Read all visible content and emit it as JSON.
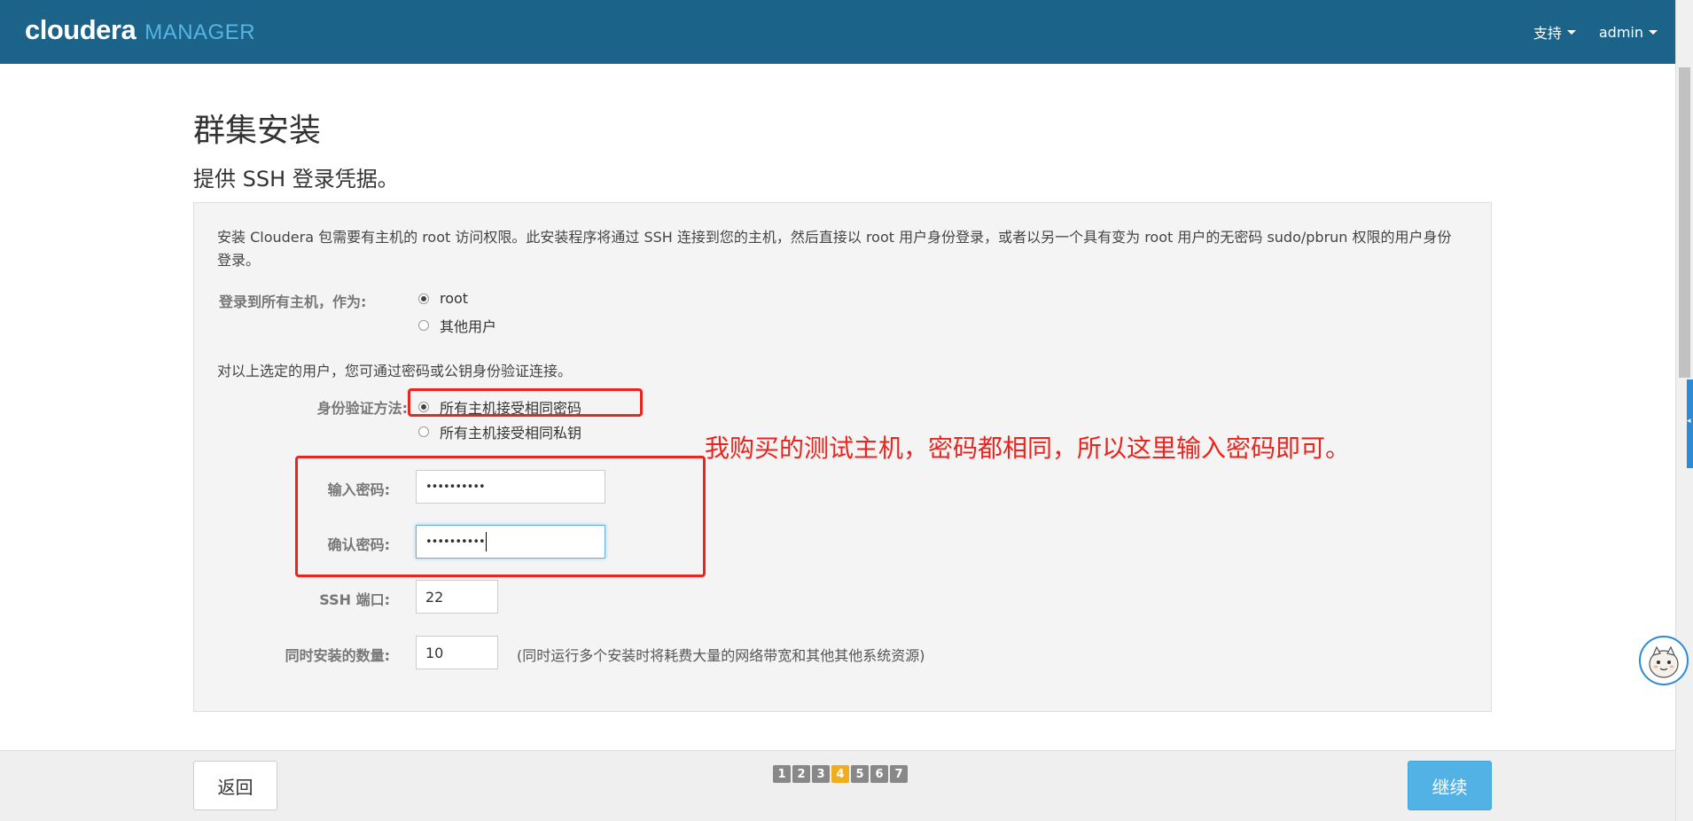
{
  "header": {
    "brand_primary": "cloudera",
    "brand_secondary": "MANAGER",
    "support_menu": "支持",
    "user_menu": "admin"
  },
  "page": {
    "title": "群集安装",
    "subtitle": "提供 SSH 登录凭据。"
  },
  "form": {
    "intro": "安装 Cloudera 包需要有主机的 root 访问权限。此安装程序将通过 SSH 连接到您的主机，然后直接以 root 用户身份登录，或者以另一个具有变为 root 用户的无密码 sudo/pbrun 权限的用户身份登录。",
    "login_as_label": "登录到所有主机，作为:",
    "login_options": [
      {
        "label": "root",
        "checked": true
      },
      {
        "label": "其他用户",
        "checked": false
      }
    ],
    "auth_intro": "对以上选定的用户，您可通过密码或公钥身份验证连接。",
    "auth_method_label": "身份验证方法:",
    "auth_options": [
      {
        "label": "所有主机接受相同密码",
        "checked": true
      },
      {
        "label": "所有主机接受相同私钥",
        "checked": false
      }
    ],
    "password_label": "输入密码:",
    "password_value": "••••••••••",
    "confirm_label": "确认密码:",
    "confirm_value": "••••••••••",
    "ssh_port_label": "SSH 端口:",
    "ssh_port_value": "22",
    "concurrent_label": "同时安装的数量:",
    "concurrent_value": "10",
    "concurrent_note": "(同时运行多个安装时将耗费大量的网络带宽和其他其他系统资源)"
  },
  "annotation": {
    "text": "我购买的测试主机，密码都相同，所以这里输入密码即可。",
    "color": "#e8251e"
  },
  "footer": {
    "back_label": "返回",
    "continue_label": "继续",
    "steps": [
      "1",
      "2",
      "3",
      "4",
      "5",
      "6",
      "7"
    ],
    "current_step": 4
  },
  "colors": {
    "navbar": "#1b6388",
    "accent": "#56b5e3",
    "continue_button": "#52b2e5",
    "active_step": "#f0ad1e"
  }
}
